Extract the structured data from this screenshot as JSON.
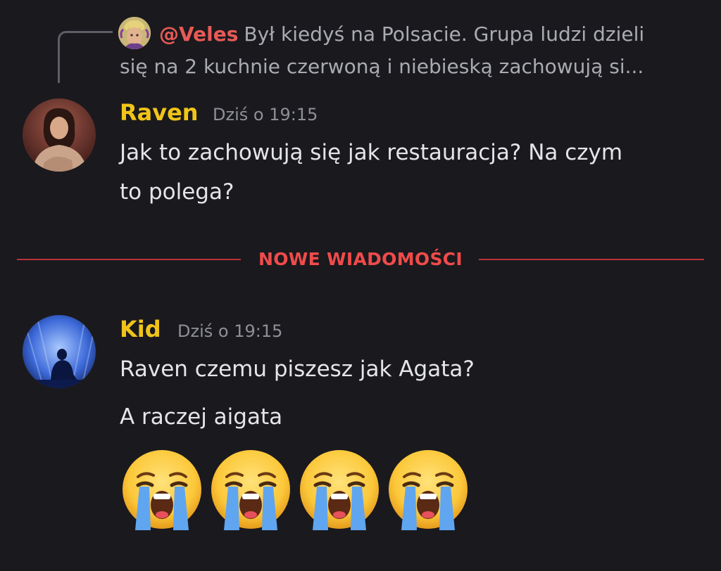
{
  "reply": {
    "author": "@Veles",
    "text_line1": "Był kiedyś na Polsacie. Grupa ludzi dzieli",
    "text_line2": "się na 2 kuchnie czerwoną i niebieską zachowują si..."
  },
  "messages": [
    {
      "author": "Raven",
      "timestamp": "Dziś o 19:15",
      "lines": [
        "Jak to zachowują się jak restauracja? Na czym",
        "to polega?"
      ]
    },
    {
      "author": "Kid",
      "timestamp": "Dziś o 19:15",
      "lines": [
        "Raven czemu piszesz jak Agata?",
        "A raczej aigata"
      ],
      "emoji": [
        "loudly-crying-face",
        "loudly-crying-face",
        "loudly-crying-face",
        "loudly-crying-face"
      ]
    }
  ],
  "divider": {
    "label": "NOWE WIADOMOŚCI"
  },
  "colors": {
    "background": "#1a1a1e",
    "username": "#f0c419",
    "reply_author": "#e85a55",
    "divider": "#f04b4b"
  }
}
